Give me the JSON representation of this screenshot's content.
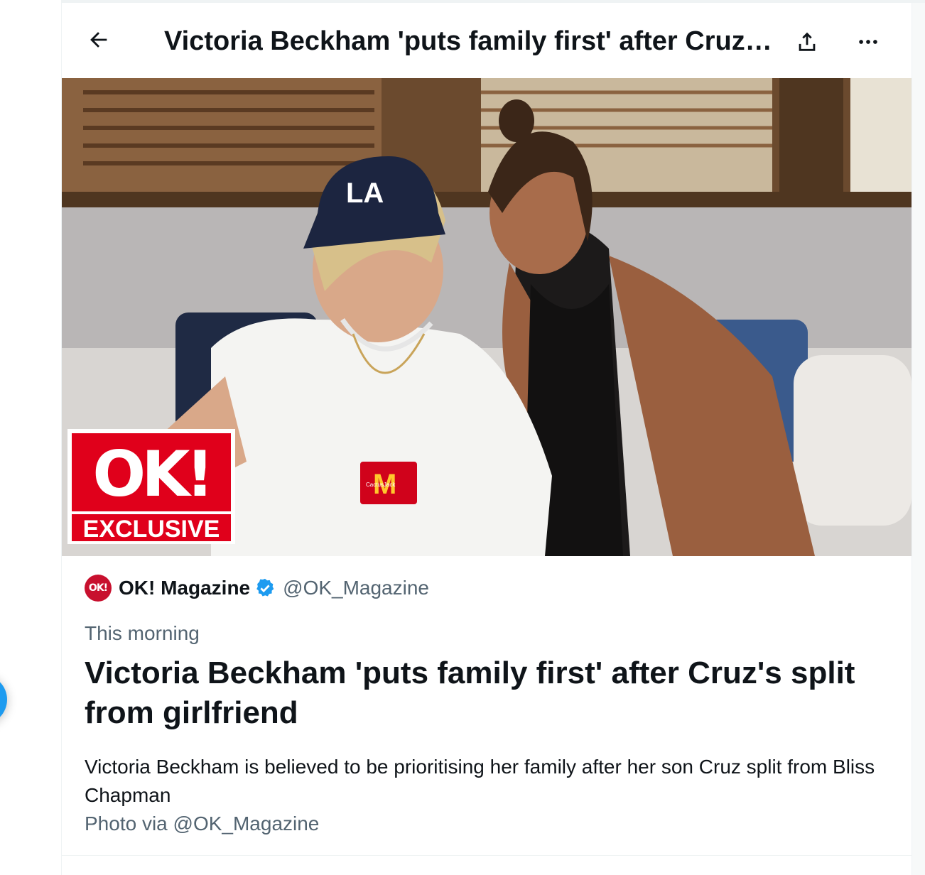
{
  "header": {
    "title": "Victoria Beckham 'puts family first' after Cruz's split from girlfriend"
  },
  "photo": {
    "badge_logo": "OK!",
    "badge_caption": "EXCLUSIVE",
    "cap_text": "LA",
    "shirt_logo_text": "CactusJack"
  },
  "card": {
    "avatar_text": "OK!",
    "author_name": "OK! Magazine",
    "author_handle": "@OK_Magazine",
    "time": "This morning",
    "title": "Victoria Beckham 'puts family first' after Cruz's split from girlfriend",
    "description": "Victoria Beckham is believed to be prioritising her family after her son Cruz split from Bliss Chapman",
    "photo_credit": "Photo via @OK_Magazine"
  },
  "colors": {
    "accent": "#1d9bf0",
    "ok_red": "#e0001b",
    "text_primary": "#0f1419",
    "text_secondary": "#536471"
  },
  "icons": {
    "back": "arrow-left-icon",
    "share": "share-icon",
    "more": "more-horizontal-icon",
    "verified": "verified-badge-icon"
  }
}
